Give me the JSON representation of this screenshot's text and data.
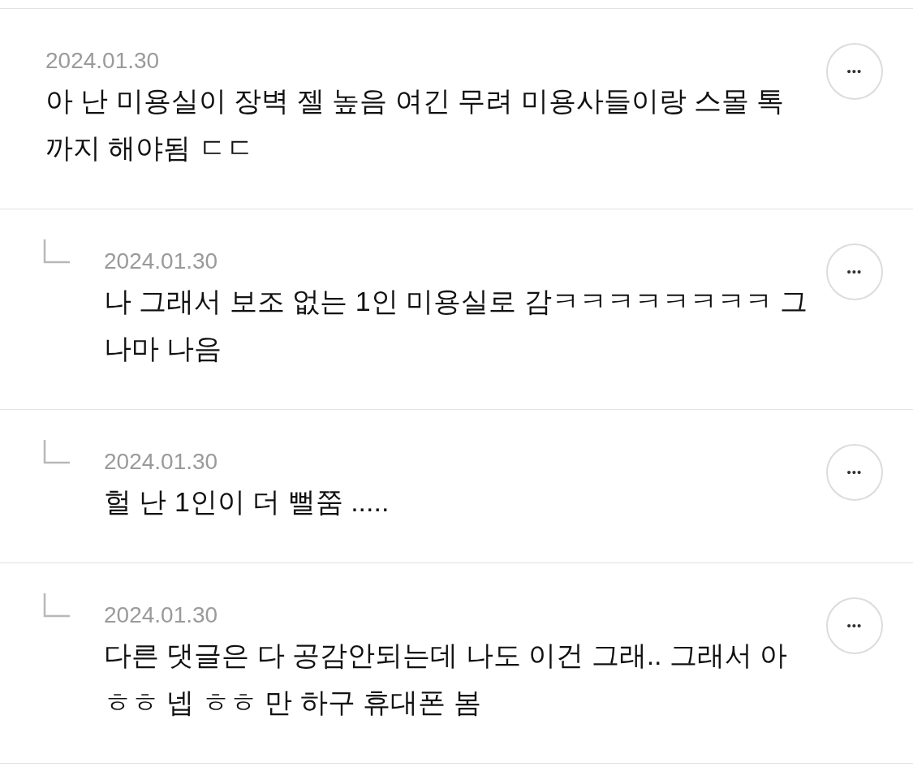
{
  "comments": [
    {
      "kind": "comment",
      "date": "2024.01.30",
      "text": "아 난 미용실이 장벽 젤 높음 여긴 무려 미용사들이랑 스몰 톡까지 해야됨 ㄷㄷ",
      "more": "•••"
    },
    {
      "kind": "reply",
      "date": "2024.01.30",
      "text": "나 그래서 보조 없는 1인 미용실로 감ㅋㅋㅋㅋㅋㅋㅋㅋ 그나마 나음",
      "more": "•••"
    },
    {
      "kind": "reply",
      "date": "2024.01.30",
      "text": "헐 난 1인이 더 뻘쭘 .....",
      "more": "•••"
    },
    {
      "kind": "reply",
      "date": "2024.01.30",
      "text": "다른 댓글은 다 공감안되는데 나도 이건 그래.. 그래서 아 ㅎㅎ 넵 ㅎㅎ 만 하구 휴대폰 봄",
      "more": "•••"
    }
  ]
}
